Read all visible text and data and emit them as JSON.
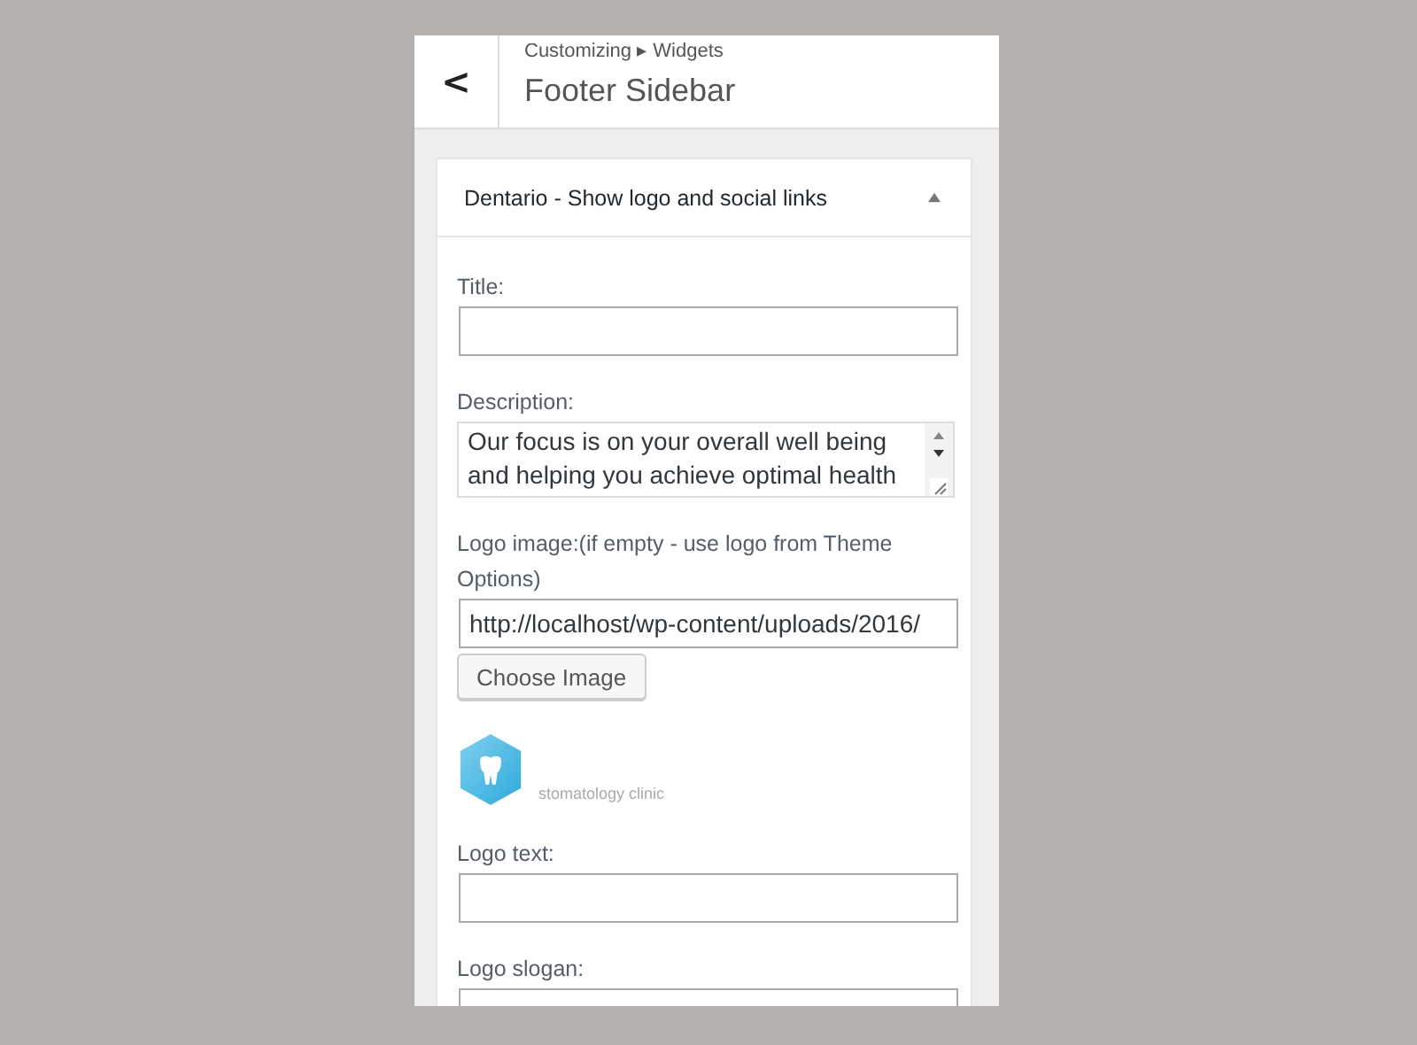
{
  "header": {
    "breadcrumb": "Customizing ▸ Widgets",
    "title": "Footer Sidebar",
    "back": "<"
  },
  "widget": {
    "title": "Dentario - Show logo and social links",
    "expanded": true,
    "fields": [
      {
        "kind": "input",
        "label": "Title:"
      },
      {
        "kind": "textarea",
        "label": "Description:",
        "value": "Our focus is on your overall well being and helping you achieve optimal health"
      },
      {
        "kind": "input",
        "label": "Logo image:(if empty - use logo from Theme Options)",
        "value": "http://localhost/wp-content/uploads/2016/",
        "button": "Choose Image",
        "preview_text": "stomatology clinic"
      },
      {
        "kind": "input",
        "label": "Logo text:"
      },
      {
        "kind": "input",
        "label": "Logo slogan:"
      }
    ]
  }
}
